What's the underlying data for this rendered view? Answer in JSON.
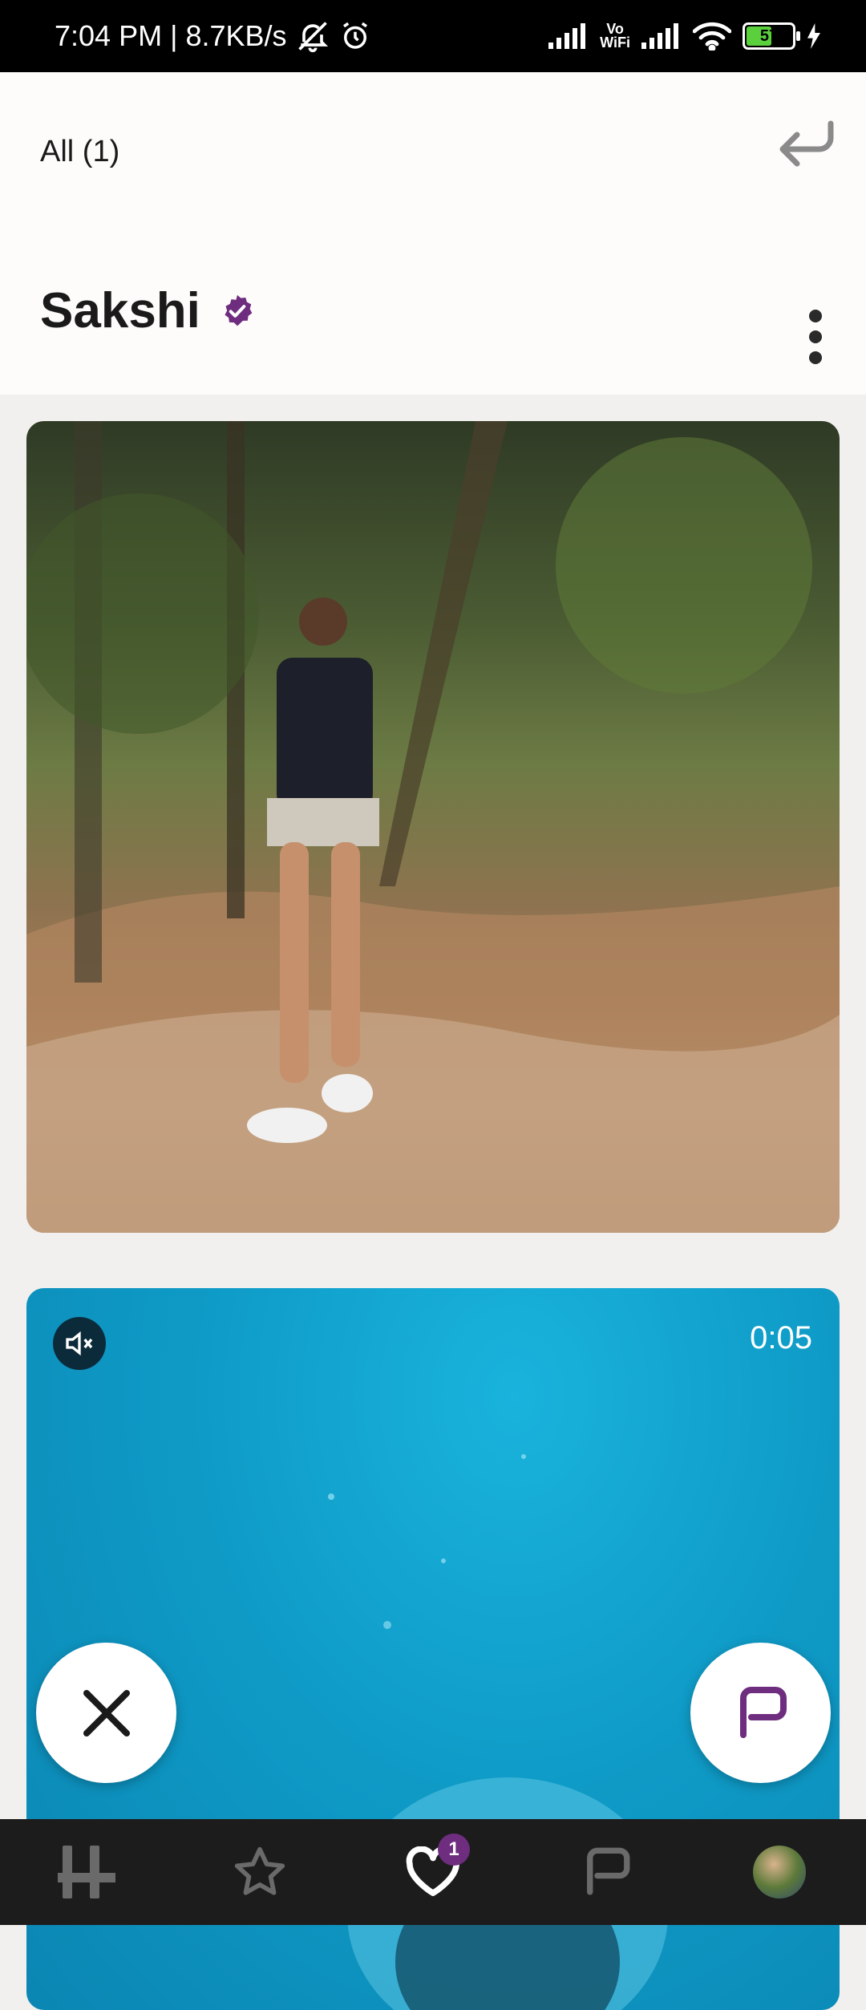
{
  "status_bar": {
    "time": "7:04 PM",
    "separator": "|",
    "speed": "8.7KB/s",
    "vowifi_top": "Vo",
    "vowifi_bottom": "WiFi",
    "battery_percent": "57",
    "battery_level": 57
  },
  "header": {
    "filter_label": "All (1)",
    "profile_name": "Sakshi"
  },
  "video": {
    "time": "0:05"
  },
  "bottom_nav": {
    "likes_badge": "1"
  },
  "colors": {
    "accent_purple": "#6e2d7e",
    "nav_background": "#1c1c1c",
    "video_blue": "#0f9bc7"
  },
  "icons": {
    "undo": "undo-arrow-icon",
    "menu": "more-vertical-icon",
    "verified": "verified-badge-icon",
    "mute": "speaker-muted-icon",
    "pass": "x-icon",
    "comment": "speech-bubble-icon",
    "nav": [
      "hinge-logo-icon",
      "star-icon",
      "heart-icon",
      "chat-icon",
      "avatar"
    ]
  }
}
